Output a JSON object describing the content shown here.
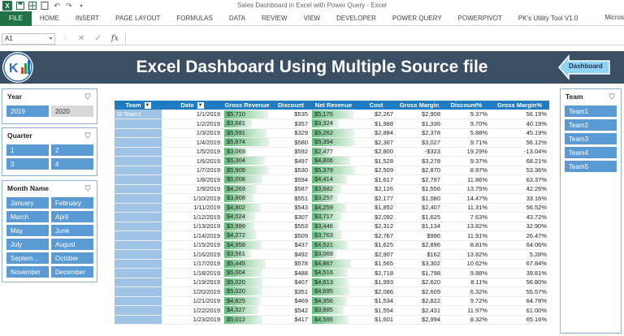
{
  "window": {
    "title": "Sales Dashboard in Excel with Power Query - Excel",
    "user": "Micros"
  },
  "ribbon": {
    "tabs": [
      "FILE",
      "HOME",
      "INSERT",
      "PAGE LAYOUT",
      "FORMULAS",
      "DATA",
      "REVIEW",
      "VIEW",
      "DEVELOPER",
      "POWER QUERY",
      "POWERPIVOT",
      "PK's Utility Tool V1.0"
    ]
  },
  "formula_bar": {
    "name_box": "A1",
    "fx": "fx",
    "cancel": "✕",
    "enter": "✓"
  },
  "banner": {
    "title": "Excel Dashboard Using Multiple Source file",
    "dashboard_button": "Dashboard"
  },
  "slicers": {
    "year": {
      "title": "Year",
      "items": [
        "2019",
        "2020"
      ]
    },
    "quarter": {
      "title": "Quarter",
      "items": [
        "1",
        "2",
        "3",
        "4"
      ]
    },
    "month": {
      "title": "Month Name",
      "items": [
        "January",
        "February",
        "March",
        "April",
        "May",
        "June",
        "July",
        "August",
        "Septem...",
        "October",
        "November",
        "December"
      ]
    },
    "team": {
      "title": "Team",
      "items": [
        "Team1",
        "Team2",
        "Team3",
        "Team4",
        "Team5"
      ]
    }
  },
  "table": {
    "headers": [
      "Team",
      "Date",
      "Gross Revenue",
      "Discount",
      "Net Revenue",
      "Cost",
      "Gross Margin",
      "Discount%",
      "Gross Margin%"
    ],
    "team_label": "Team1",
    "rows": [
      [
        "1/1/2019",
        "$5,710",
        "$535",
        "$5,175",
        "$2,267",
        "$2,908",
        "9.37%",
        "56.19%"
      ],
      [
        "1/2/2019",
        "$3,681",
        "$357",
        "$3,324",
        "$1,988",
        "$1,336",
        "9.70%",
        "40.19%"
      ],
      [
        "1/3/2019",
        "$5,591",
        "$329",
        "$5,262",
        "$2,884",
        "$2,378",
        "5.88%",
        "45.19%"
      ],
      [
        "1/4/2019",
        "$5,974",
        "$580",
        "$5,394",
        "$2,367",
        "$3,027",
        "9.71%",
        "56.12%"
      ],
      [
        "1/5/2019",
        "$3,069",
        "$592",
        "$2,477",
        "$2,800",
        "-$323",
        "19.29%",
        "-13.04%"
      ],
      [
        "1/6/2019",
        "$5,304",
        "$497",
        "$4,806",
        "$1,528",
        "$3,278",
        "9.37%",
        "68.21%"
      ],
      [
        "1/7/2019",
        "$5,909",
        "$530",
        "$5,379",
        "$2,509",
        "$2,870",
        "8.97%",
        "53.36%"
      ],
      [
        "1/8/2019",
        "$5,008",
        "$594",
        "$4,414",
        "$1,617",
        "$2,797",
        "11.86%",
        "63.37%"
      ],
      [
        "1/9/2019",
        "$4,269",
        "$587",
        "$3,682",
        "$2,126",
        "$1,556",
        "13.75%",
        "42.26%"
      ],
      [
        "1/10/2019",
        "$3,808",
        "$551",
        "$3,257",
        "$2,177",
        "$1,080",
        "14.47%",
        "33.16%"
      ],
      [
        "1/11/2019",
        "$4,802",
        "$543",
        "$4,259",
        "$1,852",
        "$2,407",
        "11.31%",
        "56.52%"
      ],
      [
        "1/12/2019",
        "$4,024",
        "$307",
        "$3,717",
        "$2,092",
        "$1,625",
        "7.63%",
        "43.72%"
      ],
      [
        "1/13/2019",
        "$3,999",
        "$553",
        "$3,446",
        "$2,312",
        "$1,134",
        "13.82%",
        "32.90%"
      ],
      [
        "1/14/2019",
        "$4,272",
        "$509",
        "$3,763",
        "$2,767",
        "$996",
        "11.91%",
        "26.47%"
      ],
      [
        "1/15/2019",
        "$4,958",
        "$437",
        "$4,521",
        "$1,625",
        "$2,896",
        "8.81%",
        "64.06%"
      ],
      [
        "1/16/2019",
        "$3,561",
        "$492",
        "$3,069",
        "$2,907",
        "$162",
        "13.82%",
        "5.28%"
      ],
      [
        "1/17/2019",
        "$5,445",
        "$578",
        "$4,867",
        "$1,565",
        "$3,302",
        "10.62%",
        "67.84%"
      ],
      [
        "1/18/2019",
        "$5,004",
        "$488",
        "$4,516",
        "$2,718",
        "$1,798",
        "9.88%",
        "39.81%"
      ],
      [
        "1/19/2019",
        "$5,020",
        "$407",
        "$4,613",
        "$1,993",
        "$2,620",
        "8.11%",
        "56.80%"
      ],
      [
        "1/20/2019",
        "$5,020",
        "$351",
        "$4,695",
        "$2,086",
        "$2,609",
        "6.32%",
        "55.57%"
      ],
      [
        "1/21/2019",
        "$4,825",
        "$469",
        "$4,356",
        "$1,534",
        "$2,822",
        "9.72%",
        "64.78%"
      ],
      [
        "1/22/2019",
        "$4,527",
        "$542",
        "$3,985",
        "$1,554",
        "$2,431",
        "11.97%",
        "61.00%"
      ],
      [
        "1/23/2019",
        "$5,012",
        "$417",
        "$4,595",
        "$1,601",
        "$2,994",
        "8.32%",
        "65.16%"
      ]
    ]
  },
  "colors": {
    "ribbon_green": "#217346",
    "banner_bg": "#3a4e64",
    "header_blue": "#1f7cc2",
    "slicer_selected": "#5b9bd5",
    "databar_green": "#63be7b"
  }
}
